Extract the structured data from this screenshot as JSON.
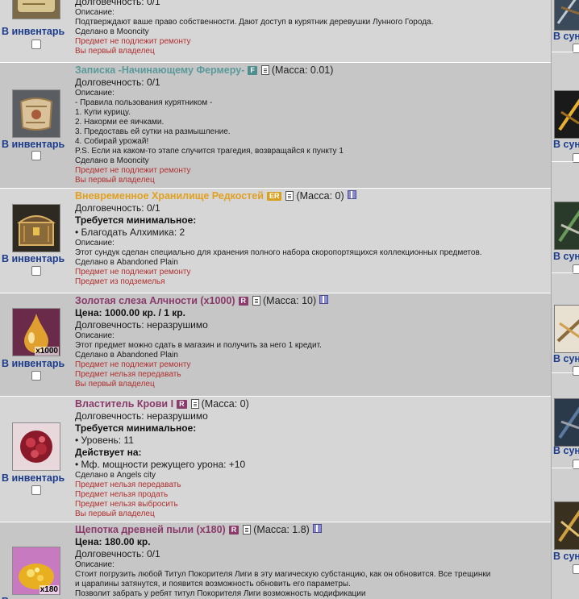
{
  "colors": {
    "name_scroll": "#5a9a9a",
    "name_gold": "#e0a020",
    "name_purple": "#8a3a6a",
    "link": "#1c3c8c",
    "red_text": "#b03030",
    "badge_f": "#4e8e8e",
    "badge_er": "#d8a020",
    "badge_r": "#8a3c6a"
  },
  "inventory": {
    "items": [
      {
        "to_inventory": "В инвентарь",
        "icon": "scroll-icon",
        "lines": [
          {
            "text": "Долговечность: 0/1",
            "style": "l12"
          },
          {
            "text": "Описание:",
            "style": "s10"
          },
          {
            "text": "Подтверждают ваше право собственности. Дают доступ в курятник деревушки Лунного Города.",
            "style": "s10"
          },
          {
            "text": "Сделано в Mooncity",
            "style": "s10"
          },
          {
            "text": "Предмет не подлежит ремонту",
            "style": "red"
          },
          {
            "text": "Вы первый владелец",
            "style": "red"
          }
        ]
      },
      {
        "to_inventory": "В инвентарь",
        "icon": "note-scroll-icon",
        "name": "Записка -Начинающему Фермеру-",
        "badge": "F",
        "mass": "(Масса: 0.01)",
        "lines": [
          {
            "text": "Долговечность: 0/1",
            "style": "l12"
          },
          {
            "text": "Описание:",
            "style": "s10"
          },
          {
            "text": "- Правила пользования курятником -",
            "style": "s10"
          },
          {
            "text": "1. Купи курицу.",
            "style": "s10"
          },
          {
            "text": "2. Накорми ее яичками.",
            "style": "s10"
          },
          {
            "text": "3. Предоставь ей сутки на размышление.",
            "style": "s10"
          },
          {
            "text": "4. Собирай урожай!",
            "style": "s10"
          },
          {
            "text": "P.S. Если на каком-то этапе случится трагедия, возвращайся к пункту 1",
            "style": "s10"
          },
          {
            "text": "Сделано в Mooncity",
            "style": "s10"
          },
          {
            "text": "Предмет не подлежит ремонту",
            "style": "red"
          },
          {
            "text": "Вы первый владелец",
            "style": "red"
          }
        ]
      },
      {
        "to_inventory": "В инвентарь",
        "icon": "treasure-chest-icon",
        "name": "Вневременное Хранилище Редкостей",
        "badge": "ER",
        "mass": "(Масса: 0)",
        "gift": true,
        "lines": [
          {
            "text": "Долговечность: 0/1",
            "style": "l12"
          },
          {
            "text": "Требуется минимальное:",
            "style": "b12"
          },
          {
            "text": "• Благодать Алхимика: 2",
            "style": "l12"
          },
          {
            "text": "Описание:",
            "style": "s10"
          },
          {
            "text": "Этот сундук сделан специально для хранения полного набора скоропортящихся коллекционных предметов.",
            "style": "s10"
          },
          {
            "text": "Сделано в Abandoned Plain",
            "style": "s10"
          },
          {
            "text": "Предмет не подлежит ремонту",
            "style": "red"
          },
          {
            "text": "Предмет из подземелья",
            "style": "red"
          }
        ]
      },
      {
        "to_inventory": "В инвентарь",
        "icon": "golden-tear-icon",
        "quantity": "x1000",
        "name": "Золотая слеза Алчности (x1000)",
        "badge": "R",
        "mass": "(Масса: 10)",
        "gift": true,
        "lines": [
          {
            "text": "Цена: 1000.00 кр. / 1 кр.",
            "style": "b12"
          },
          {
            "text": "Долговечность: неразрушимо",
            "style": "l12"
          },
          {
            "text": "Описание:",
            "style": "s10"
          },
          {
            "text": "Этот предмет можно сдать в магазин и получить за него 1 кредит.",
            "style": "s10"
          },
          {
            "text": "Сделано в Abandoned Plain",
            "style": "s10"
          },
          {
            "text": "Предмет не подлежит ремонту",
            "style": "red"
          },
          {
            "text": "Предмет нельзя передавать",
            "style": "red"
          },
          {
            "text": "Вы первый владелец",
            "style": "red"
          }
        ]
      },
      {
        "to_inventory": "В инвентарь",
        "icon": "blood-gem-icon",
        "name": "Властитель Крови I",
        "badge": "R",
        "mass": "(Масса: 0)",
        "lines": [
          {
            "text": "Долговечность: неразрушимо",
            "style": "l12"
          },
          {
            "text": "Требуется минимальное:",
            "style": "b12"
          },
          {
            "text": "• Уровень: 11",
            "style": "l12"
          },
          {
            "text": "Действует на:",
            "style": "b12"
          },
          {
            "text": "• Мф. мощности режущего урона: +10",
            "style": "l12"
          },
          {
            "text": "Сделано в Angels city",
            "style": "s10"
          },
          {
            "text": "Предмет нельзя передавать",
            "style": "red"
          },
          {
            "text": "Предмет нельзя продать",
            "style": "red"
          },
          {
            "text": "Предмет нельзя выбросить",
            "style": "red"
          },
          {
            "text": "Вы первый владелец",
            "style": "red"
          }
        ]
      },
      {
        "to_inventory": "В инвентарь",
        "icon": "golden-dust-icon",
        "quantity": "x180",
        "name": "Щепотка древней пыли (x180)",
        "badge": "R",
        "mass": "(Масса: 1.8)",
        "gift": true,
        "lines": [
          {
            "text": "Цена: 180.00 кр.",
            "style": "b12"
          },
          {
            "text": "Долговечность: 0/1",
            "style": "l12"
          },
          {
            "text": "Описание:",
            "style": "s10"
          },
          {
            "text": "Стоит погрузить любой Титул Покорителя Лиги в эту магическую субстанцию, как он обновится. Все трещинки",
            "style": "s10"
          },
          {
            "text": "и царапины затянутся, и появится возможность обновить его параметры.",
            "style": "s10"
          },
          {
            "text": "Позволит забрать у ребят титул Покорителя Лиги возможность модификации",
            "style": "s10"
          }
        ]
      }
    ]
  },
  "side": {
    "label": "В сун",
    "icons": [
      "crossbow-icon",
      "golden-crossbow-icon",
      "green-crossbow-icon",
      "ornate-crossbow-icon",
      "dark-crossbow-icon",
      "gold-crossbow-icon"
    ]
  }
}
